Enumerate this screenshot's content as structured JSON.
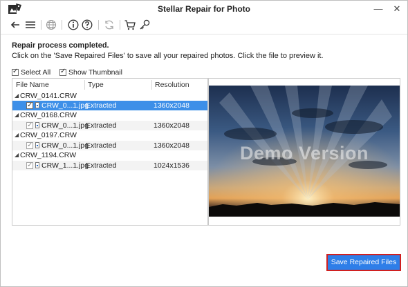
{
  "app": {
    "title": "Stellar Repair for Photo"
  },
  "window_controls": {
    "minimize_glyph": "—",
    "close_glyph": "✕"
  },
  "toolbar": {
    "icons": [
      "back-arrow-icon",
      "menu-icon",
      "globe-icon",
      "info-icon",
      "help-icon",
      "refresh-icon",
      "cart-icon",
      "key-icon"
    ]
  },
  "status": {
    "heading": "Repair process completed.",
    "message": "Click on the 'Save Repaired Files' to save all your repaired photos. Click the file to preview it."
  },
  "options": {
    "select_all": {
      "label": "Select All",
      "checked": true
    },
    "show_thumbnail": {
      "label": "Show Thumbnail",
      "checked": true
    }
  },
  "table": {
    "headers": [
      "File Name",
      "Type",
      "Resolution"
    ],
    "groups": [
      {
        "folder": "CRW_0141.CRW",
        "file": {
          "name": "CRW_0...1.jpg",
          "type": "Extracted",
          "resolution": "1360x2048",
          "selected": true
        }
      },
      {
        "folder": "CRW_0168.CRW",
        "file": {
          "name": "CRW_0...1.jpg",
          "type": "Extracted",
          "resolution": "1360x2048",
          "selected": false
        }
      },
      {
        "folder": "CRW_0197.CRW",
        "file": {
          "name": "CRW_0...1.jpg",
          "type": "Extracted",
          "resolution": "1360x2048",
          "selected": false
        }
      },
      {
        "folder": "CRW_1194.CRW",
        "file": {
          "name": "CRW_1...1.jpg",
          "type": "Extracted",
          "resolution": "1024x1536",
          "selected": false
        }
      }
    ]
  },
  "preview": {
    "watermark": "Demo Version"
  },
  "actions": {
    "save_label": "Save Repaired Files"
  },
  "colors": {
    "accent": "#2e7ee8",
    "selection": "#3d8fe8",
    "highlight_border": "#d02020"
  }
}
